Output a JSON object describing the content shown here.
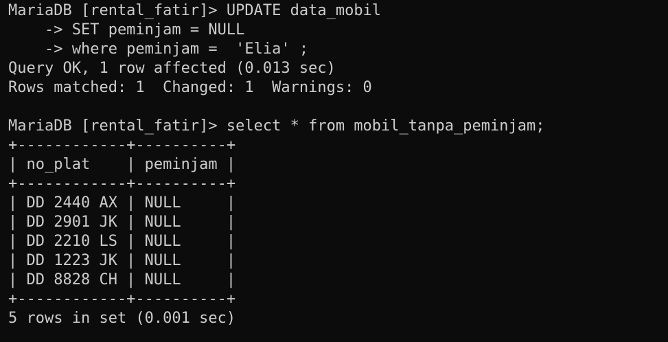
{
  "terminal": {
    "lines": [
      "MariaDB [rental_fatir]> UPDATE data_mobil",
      "    -> SET peminjam = NULL",
      "    -> where peminjam =  'Elia' ;",
      "Query OK, 1 row affected (0.013 sec)",
      "Rows matched: 1  Changed: 1  Warnings: 0",
      "",
      "MariaDB [rental_fatir]> select * from mobil_tanpa_peminjam;",
      "+------------+----------+",
      "| no_plat    | peminjam |",
      "+------------+----------+",
      "| DD 2440 AX | NULL     |",
      "| DD 2901 JK | NULL     |",
      "| DD 2210 LS | NULL     |",
      "| DD 1223 JK | NULL     |",
      "| DD 8828 CH | NULL     |",
      "+------------+----------+",
      "5 rows in set (0.001 sec)"
    ]
  },
  "colors": {
    "background": "#0c0c0c",
    "foreground": "#cccccc"
  }
}
